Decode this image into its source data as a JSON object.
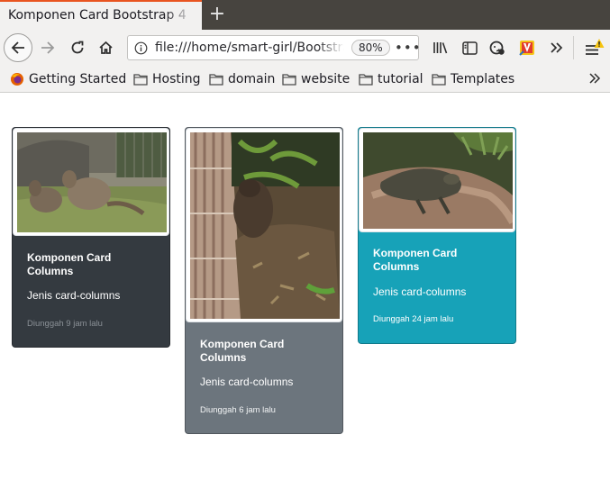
{
  "browser": {
    "tab_title": "Komponen Card Bootstrap 4",
    "url": "file:///home/smart-girl/Bootstrap",
    "zoom": "80%"
  },
  "bookmarks": {
    "items": [
      {
        "label": "Getting Started",
        "icon": "firefox-icon"
      },
      {
        "label": "Hosting",
        "icon": "folder-icon"
      },
      {
        "label": "domain",
        "icon": "folder-icon"
      },
      {
        "label": "website",
        "icon": "folder-icon"
      },
      {
        "label": "tutorial",
        "icon": "folder-icon"
      },
      {
        "label": "Templates",
        "icon": "folder-icon"
      }
    ]
  },
  "cards": [
    {
      "title": "Komponen Card Columns",
      "text": "Jenis card-columns",
      "time": "Diunggah 9 jam lalu",
      "bg": "#343a40",
      "muted": true,
      "image": "wallaby photo"
    },
    {
      "title": "Komponen Card Columns",
      "text": "Jenis card-columns",
      "time": "Diunggah 6 jam lalu",
      "bg": "#6c757d",
      "muted": false,
      "image": "wombat photo"
    },
    {
      "title": "Komponen Card Columns",
      "text": "Jenis card-columns",
      "time": "Diunggah 24 jam lalu",
      "bg": "#17a2b8",
      "muted": false,
      "image": "komodo dragon photo"
    }
  ],
  "colors": {
    "accent": "#e95420",
    "dark": "#343a40",
    "secondary": "#6c757d",
    "info": "#17a2b8"
  }
}
